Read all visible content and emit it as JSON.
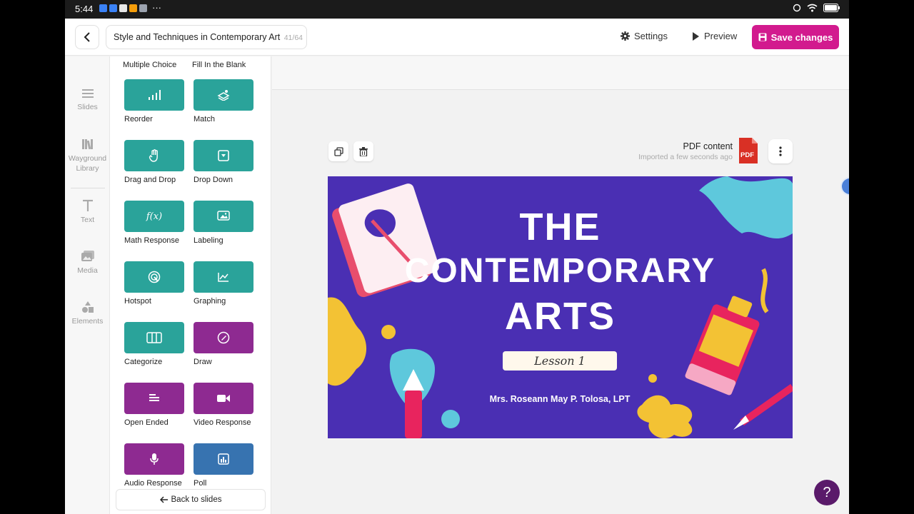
{
  "status_bar": {
    "time": "5:44",
    "more": "···"
  },
  "header": {
    "title": "Style and Techniques in Contemporary Art",
    "count": "41/64",
    "settings_label": "Settings",
    "preview_label": "Preview",
    "save_label": "Save changes",
    "accent": "#d21a8e"
  },
  "rail": {
    "items": [
      {
        "label": "Slides",
        "icon": "list-icon"
      },
      {
        "label": "Wayground Library",
        "icon": "library-icon"
      },
      {
        "label": "Text",
        "icon": "text-icon"
      },
      {
        "label": "Media",
        "icon": "media-icon"
      },
      {
        "label": "Elements",
        "icon": "shapes-icon"
      }
    ]
  },
  "panel": {
    "top_labels": [
      "Multiple Choice",
      "Fill In the Blank"
    ],
    "questions": [
      {
        "label": "Reorder",
        "icon": "bars-icon",
        "color": "teal"
      },
      {
        "label": "Match",
        "icon": "match-icon",
        "color": "teal"
      },
      {
        "label": "Drag and Drop",
        "icon": "hand-icon",
        "color": "teal"
      },
      {
        "label": "Drop Down",
        "icon": "dropdown-icon",
        "color": "teal"
      },
      {
        "label": "Math Response",
        "icon": "fx-icon",
        "color": "teal"
      },
      {
        "label": "Labeling",
        "icon": "image-label-icon",
        "color": "teal"
      },
      {
        "label": "Hotspot",
        "icon": "target-icon",
        "color": "teal"
      },
      {
        "label": "Graphing",
        "icon": "graph-icon",
        "color": "teal"
      },
      {
        "label": "Categorize",
        "icon": "columns-icon",
        "color": "teal"
      },
      {
        "label": "Draw",
        "icon": "pen-icon",
        "color": "purple"
      },
      {
        "label": "Open Ended",
        "icon": "text-lines-icon",
        "color": "purple"
      },
      {
        "label": "Video Response",
        "icon": "video-icon",
        "color": "purple"
      },
      {
        "label": "Audio Response",
        "icon": "mic-icon",
        "color": "purple"
      },
      {
        "label": "Poll",
        "icon": "poll-icon",
        "color": "blue"
      }
    ],
    "fx_text": "f(x)",
    "back_label": "Back to slides"
  },
  "canvas": {
    "pdf_title": "PDF content",
    "pdf_subtitle": "Imported a few seconds ago",
    "pdf_badge": "PDF",
    "slide": {
      "line1": "THE",
      "line2": "CONTEMPORARY",
      "line3": "ARTS",
      "lesson": "Lesson 1",
      "author": "Mrs. Roseann May P. Tolosa, LPT",
      "background": "#4a2fb3"
    }
  },
  "help_label": "?"
}
